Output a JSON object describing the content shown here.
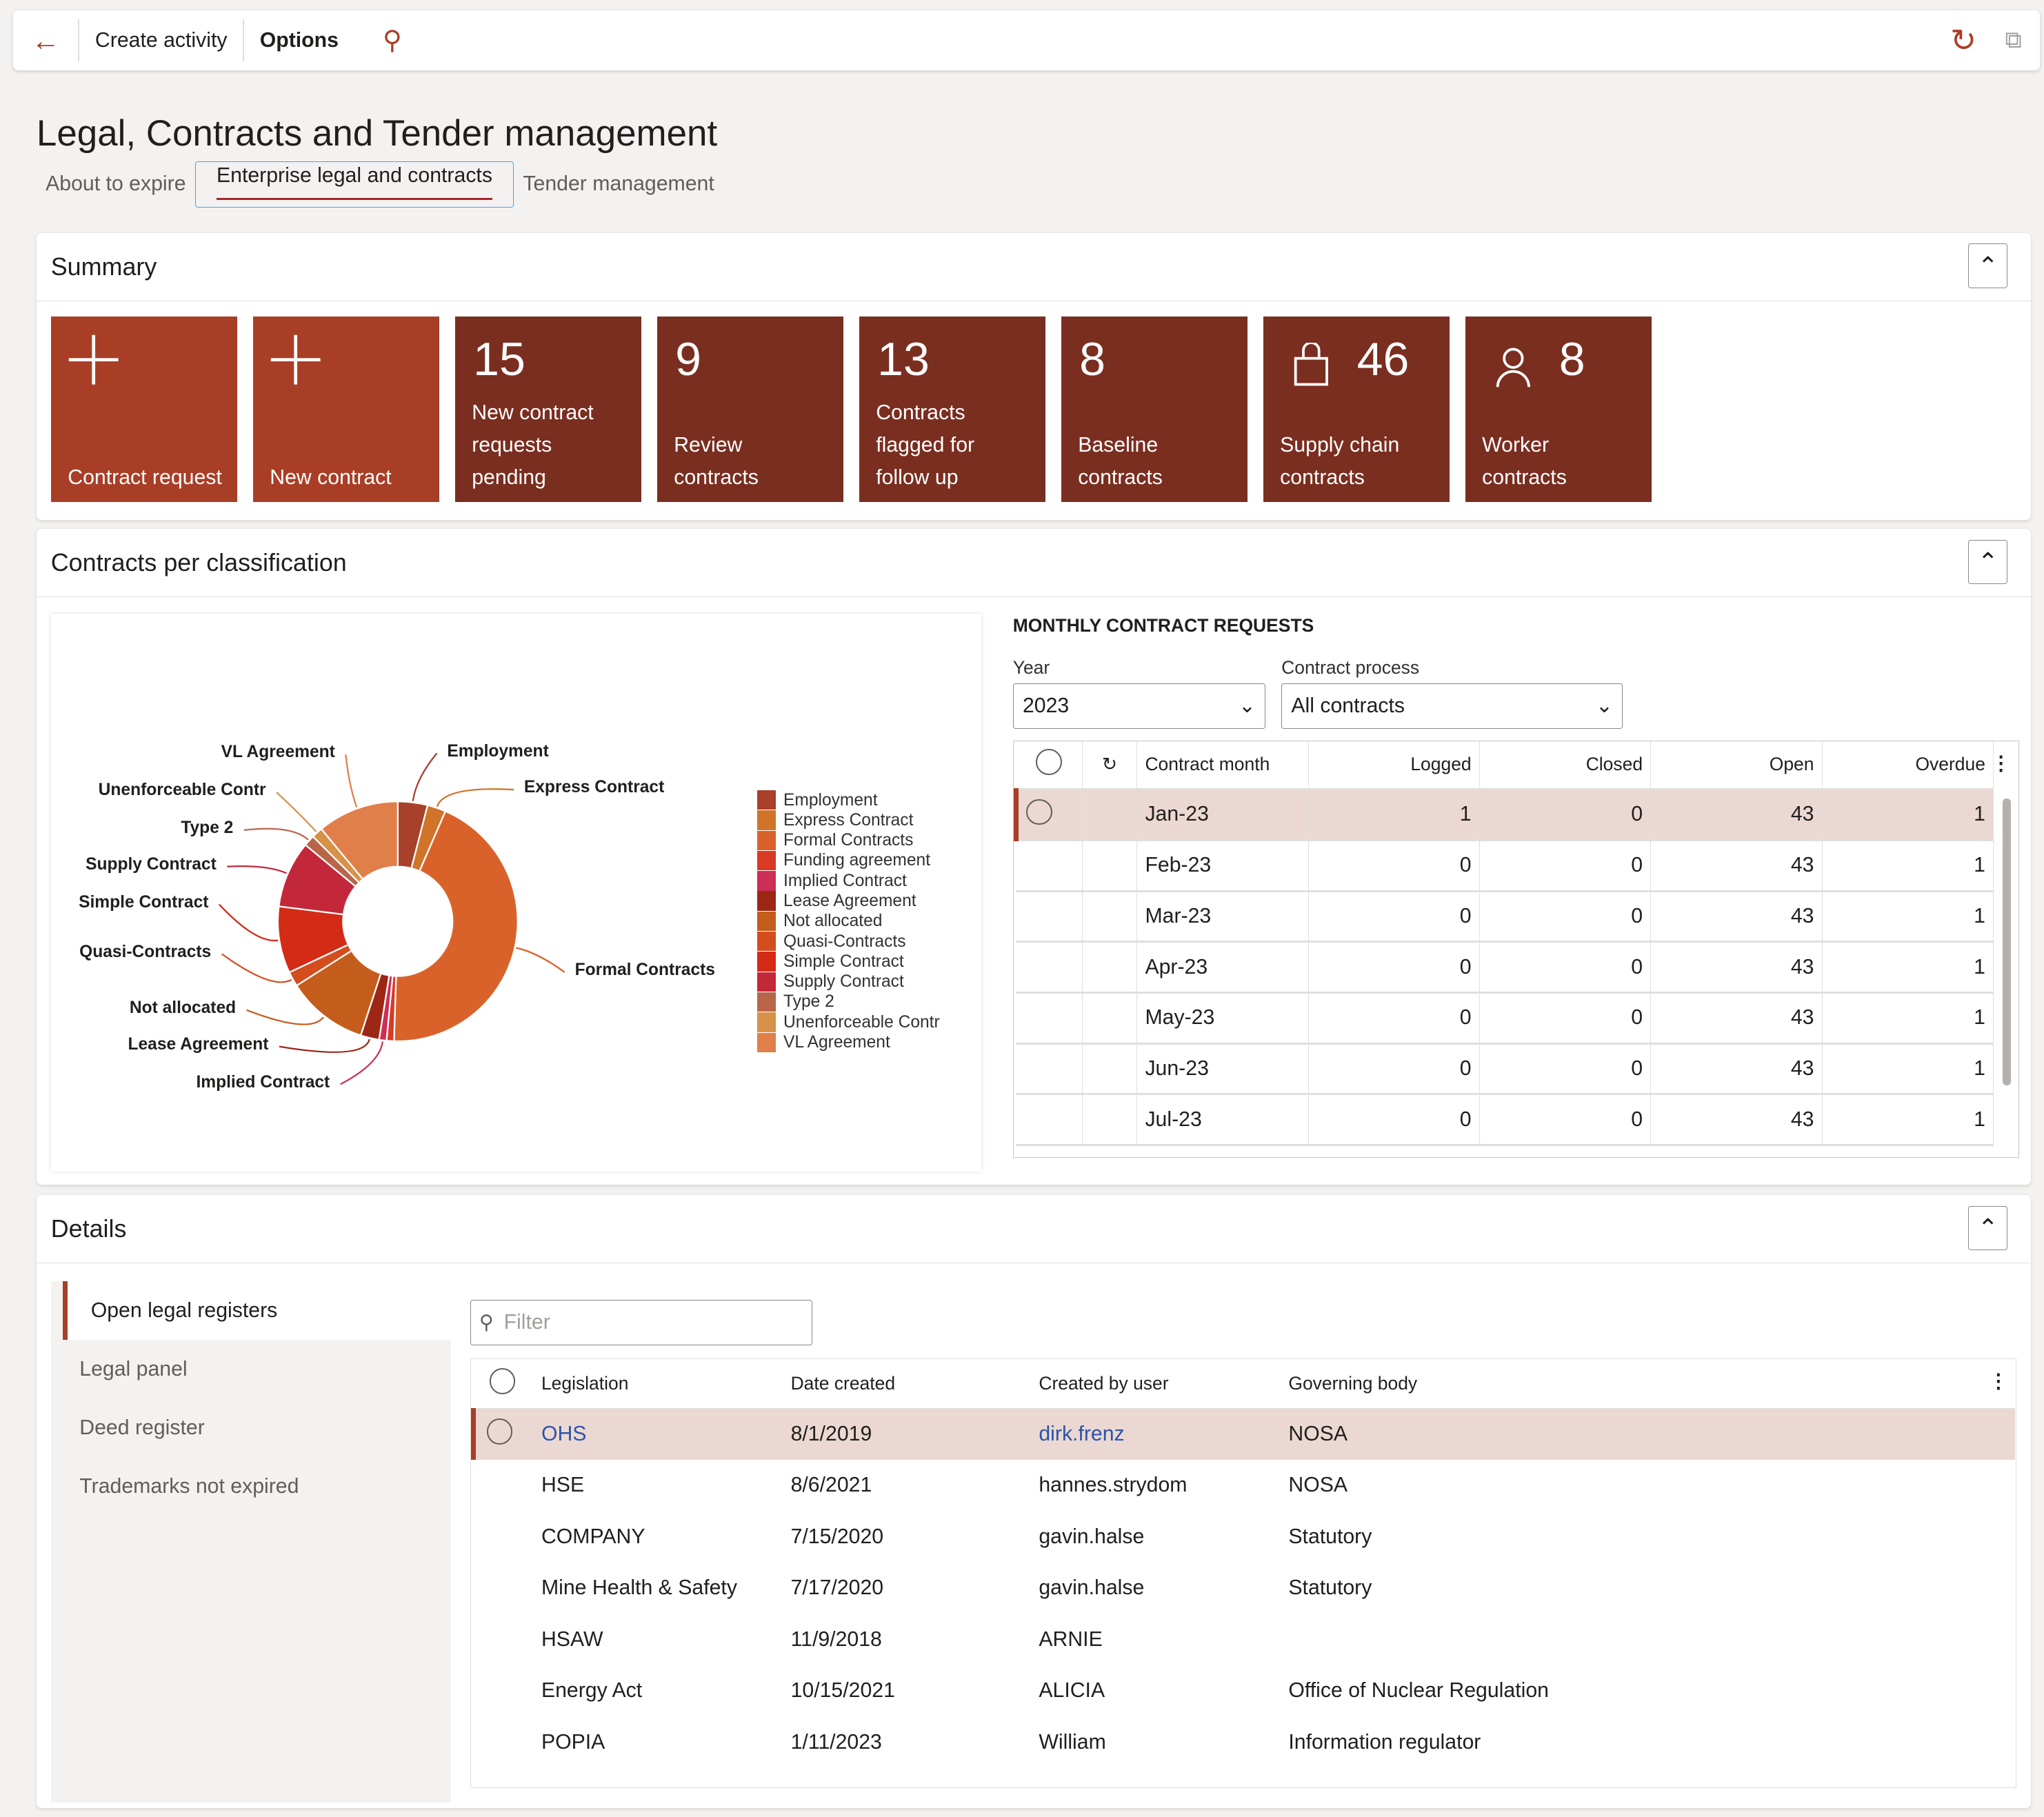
{
  "toolbar": {
    "create_activity": "Create activity",
    "options": "Options"
  },
  "page": {
    "title": "Legal, Contracts and Tender management"
  },
  "tabs": [
    {
      "label": "About to expire"
    },
    {
      "label": "Enterprise legal and contracts",
      "selected": true
    },
    {
      "label": "Tender management"
    }
  ],
  "summary": {
    "title": "Summary",
    "tiles": [
      {
        "label": "Contract request",
        "icon": "plus-icon"
      },
      {
        "label": "New contract",
        "icon": "plus-icon"
      },
      {
        "count": "15",
        "label": "New contract requests pending"
      },
      {
        "count": "9",
        "label": "Review contracts"
      },
      {
        "count": "13",
        "label": "Contracts flagged for follow up"
      },
      {
        "count": "8",
        "label": "Baseline contracts"
      },
      {
        "count": "46",
        "label": "Supply chain contracts",
        "icon": "shopping-bag-icon"
      },
      {
        "count": "8",
        "label": "Worker contracts",
        "icon": "person-icon"
      }
    ],
    "tile_color": "#7a2e20",
    "action_tile_color": "#a93e26"
  },
  "classification": {
    "title": "Contracts per classification"
  },
  "chart_data": {
    "type": "pie",
    "donut": true,
    "legend": "right",
    "categories": [
      "Employment",
      "Express Contract",
      "Formal Contracts",
      "Funding agreement",
      "Implied Contract",
      "Lease Agreement",
      "Not allocated",
      "Quasi-Contracts",
      "Simple Contract",
      "Supply Contract",
      "Type 2",
      "Unenforceable Contr",
      "VL Agreement"
    ],
    "values": [
      4,
      2.5,
      44,
      1,
      1,
      2.5,
      11,
      2,
      9,
      9,
      1.5,
      1.5,
      11
    ],
    "colors": [
      "#a8402a",
      "#cf7429",
      "#d9622a",
      "#d83a26",
      "#cc2e55",
      "#9c2714",
      "#c45c1b",
      "#d44d1e",
      "#d42b17",
      "#c2283a",
      "#b9654a",
      "#d89148",
      "#e07f4a"
    ],
    "labeled": [
      "VL Agreement",
      "Employment",
      "Unenforceable Contr",
      "Express Contract",
      "Type 2",
      "Supply Contract",
      "Simple Contract",
      "Quasi-Contracts",
      "Formal Contracts",
      "Not allocated",
      "Lease Agreement",
      "Implied Contract"
    ]
  },
  "monthly": {
    "title": "MONTHLY CONTRACT REQUESTS",
    "year_label": "Year",
    "year": "2023",
    "process_label": "Contract process",
    "process": "All contracts",
    "columns": [
      "Contract month",
      "Logged",
      "Closed",
      "Open",
      "Overdue"
    ],
    "rows": [
      [
        "Jan-23",
        "1",
        "0",
        "43",
        "1"
      ],
      [
        "Feb-23",
        "0",
        "0",
        "43",
        "1"
      ],
      [
        "Mar-23",
        "0",
        "0",
        "43",
        "1"
      ],
      [
        "Apr-23",
        "0",
        "0",
        "43",
        "1"
      ],
      [
        "May-23",
        "0",
        "0",
        "43",
        "1"
      ],
      [
        "Jun-23",
        "0",
        "0",
        "43",
        "1"
      ],
      [
        "Jul-23",
        "0",
        "0",
        "43",
        "1"
      ]
    ]
  },
  "details": {
    "title": "Details",
    "nav": [
      "Open legal registers",
      "Legal panel",
      "Deed register",
      "Trademarks not expired"
    ],
    "filter_placeholder": "Filter",
    "columns": [
      "Legislation",
      "Date created",
      "Created by user",
      "Governing body"
    ],
    "rows": [
      [
        "OHS",
        "8/1/2019",
        "dirk.frenz",
        "NOSA"
      ],
      [
        "HSE",
        "8/6/2021",
        "hannes.strydom",
        "NOSA"
      ],
      [
        "COMPANY",
        "7/15/2020",
        "gavin.halse",
        "Statutory"
      ],
      [
        "Mine Health & Safety",
        "7/17/2020",
        "gavin.halse",
        "Statutory"
      ],
      [
        "HSAW",
        "11/9/2018",
        "ARNIE",
        ""
      ],
      [
        "Energy Act",
        "10/15/2021",
        "ALICIA",
        "Office of Nuclear Regulation"
      ],
      [
        "POPIA",
        "1/11/2023",
        "William",
        "Information regulator"
      ]
    ]
  }
}
